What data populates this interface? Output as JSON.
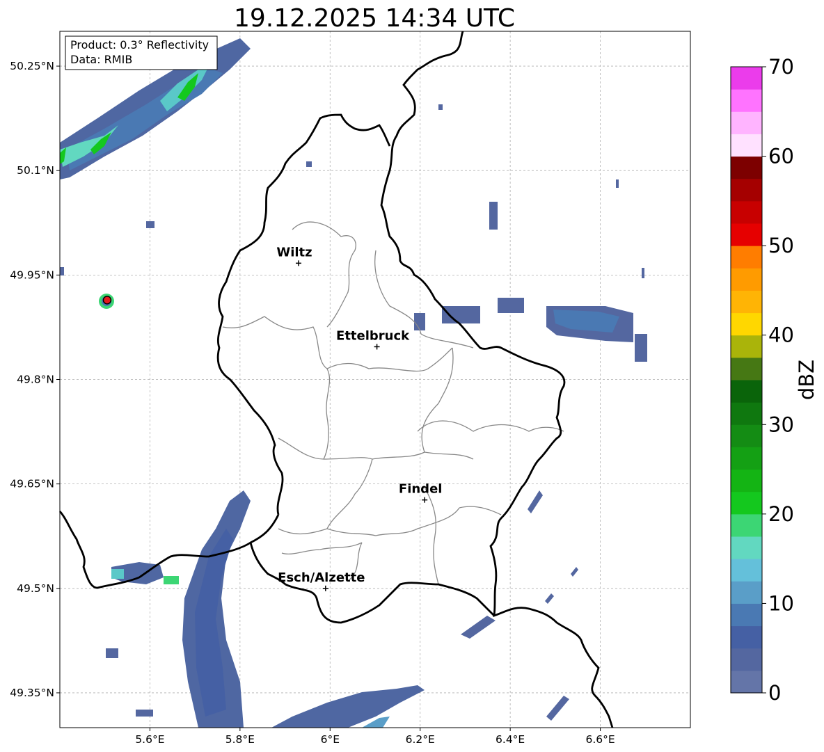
{
  "title": "19.12.2025 14:34 UTC",
  "info_box": {
    "product": "Product: 0.3° Reflectivity",
    "data": "Data: RMIB"
  },
  "map": {
    "lon_range": [
      5.4,
      6.8
    ],
    "lat_range": [
      49.3,
      50.3
    ],
    "lon_ticks": [
      {
        "value": 5.6,
        "label": "5.6°E"
      },
      {
        "value": 5.8,
        "label": "5.8°E"
      },
      {
        "value": 6.0,
        "label": "6°E"
      },
      {
        "value": 6.2,
        "label": "6.2°E"
      },
      {
        "value": 6.4,
        "label": "6.4°E"
      },
      {
        "value": 6.6,
        "label": "6.6°E"
      }
    ],
    "lat_ticks": [
      {
        "value": 50.25,
        "label": "50.25°N"
      },
      {
        "value": 50.1,
        "label": "50.1°N"
      },
      {
        "value": 49.95,
        "label": "49.95°N"
      },
      {
        "value": 49.8,
        "label": "49.8°N"
      },
      {
        "value": 49.65,
        "label": "49.65°N"
      },
      {
        "value": 49.5,
        "label": "49.5°N"
      },
      {
        "value": 49.35,
        "label": "49.35°N"
      }
    ],
    "grid": true,
    "cities": [
      {
        "name": "Wiltz",
        "lon": 5.93,
        "lat": 49.967
      },
      {
        "name": "Ettelbruck",
        "lon": 6.104,
        "lat": 49.847
      },
      {
        "name": "Findel",
        "lon": 6.21,
        "lat": 49.627
      },
      {
        "name": "Esch/Alzette",
        "lon": 5.99,
        "lat": 49.5
      }
    ],
    "radar_site": {
      "lon": 5.505,
      "lat": 49.914,
      "color": "#e41a1c"
    }
  },
  "colorbar": {
    "label": "dBZ",
    "min": 0,
    "max": 70,
    "step": 2.5,
    "tick_labels": [
      "0",
      "10",
      "20",
      "30",
      "40",
      "50",
      "60",
      "70"
    ],
    "colors": [
      "#6475a8",
      "#5467a0",
      "#4560a4",
      "#4a79b3",
      "#5a9ec8",
      "#64c0da",
      "#62d8c0",
      "#3cd674",
      "#14c81e",
      "#14b414",
      "#14a014",
      "#148c14",
      "#0f780f",
      "#0a640a",
      "#467814",
      "#aab40a",
      "#ffd700",
      "#ffb405",
      "#ff9b00",
      "#ff7d00",
      "#e60000",
      "#c80000",
      "#a50000",
      "#7d0000",
      "#ffe1ff",
      "#ffb4ff",
      "#ff73ff",
      "#eb3ceb"
    ]
  }
}
